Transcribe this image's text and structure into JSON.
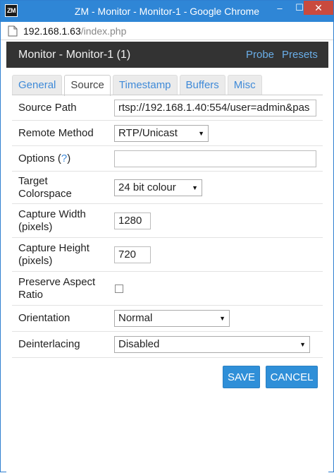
{
  "window": {
    "app_icon_text": "ZM",
    "title": "ZM - Monitor - Monitor-1 - Google Chrome",
    "minimize_glyph": "–",
    "maximize_glyph": "☐",
    "close_glyph": "✕"
  },
  "url": {
    "host": "192.168.1.63",
    "path": "/index.php"
  },
  "header": {
    "title": "Monitor - Monitor-1 (1)",
    "links": {
      "probe": "Probe",
      "presets": "Presets"
    }
  },
  "tabs": [
    {
      "label": "General",
      "active": false
    },
    {
      "label": "Source",
      "active": true
    },
    {
      "label": "Timestamp",
      "active": false
    },
    {
      "label": "Buffers",
      "active": false
    },
    {
      "label": "Misc",
      "active": false
    }
  ],
  "form": {
    "source_path": {
      "label": "Source Path",
      "value": "rtsp://192.168.1.40:554/user=admin&pas"
    },
    "remote_method": {
      "label": "Remote Method",
      "value": "RTP/Unicast"
    },
    "options": {
      "label": "Options (",
      "help": "?",
      "label_end": ")",
      "value": ""
    },
    "target_colorspace": {
      "label_line1": "Target",
      "label_line2": "Colorspace",
      "value": "24 bit colour"
    },
    "capture_width": {
      "label_line1": "Capture Width",
      "label_line2": "(pixels)",
      "value": "1280"
    },
    "capture_height": {
      "label_line1": "Capture Height",
      "label_line2": "(pixels)",
      "value": "720"
    },
    "preserve_aspect": {
      "label_line1": "Preserve Aspect",
      "label_line2": "Ratio",
      "checked": false
    },
    "orientation": {
      "label": "Orientation",
      "value": "Normal"
    },
    "deinterlacing": {
      "label": "Deinterlacing",
      "value": "Disabled"
    }
  },
  "buttons": {
    "save": "SAVE",
    "cancel": "CANCEL"
  },
  "colors": {
    "titlebar": "#2f86d6",
    "header": "#333333",
    "link": "#3f8ad8",
    "button": "#2f8fd8"
  }
}
